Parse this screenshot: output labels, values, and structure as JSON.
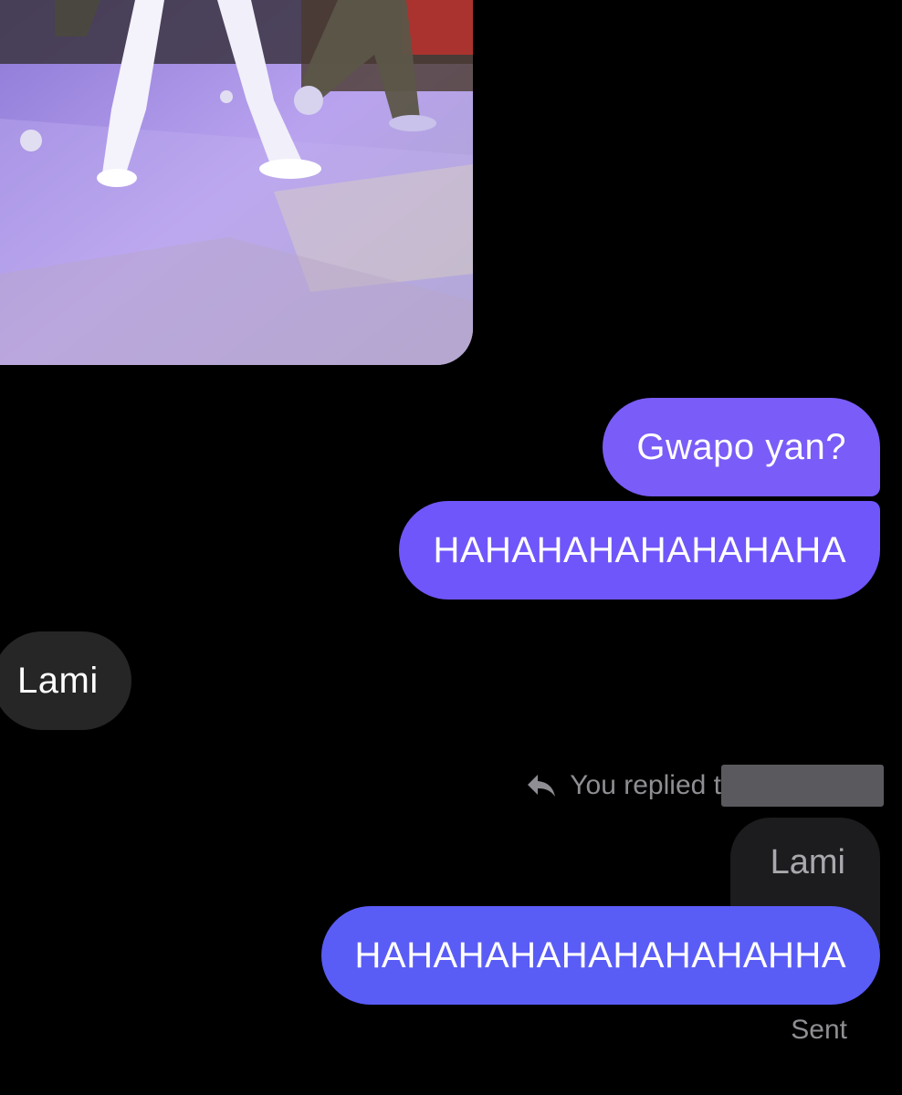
{
  "conversation": {
    "messages": [
      {
        "kind": "photo",
        "direction": "incoming"
      },
      {
        "kind": "text",
        "direction": "outgoing",
        "text": "Gwapo yan?"
      },
      {
        "kind": "text",
        "direction": "outgoing",
        "text": "HAHAHAHAHAHAHAHA"
      },
      {
        "kind": "text",
        "direction": "incoming",
        "text": "Lami"
      },
      {
        "kind": "reply",
        "direction": "outgoing",
        "reply_note": "You replied t",
        "quoted_text": "Lami",
        "text": "HAHAHAHAHAHAHAHAHHA"
      }
    ],
    "status": "Sent"
  },
  "colors": {
    "background": "#000000",
    "outgoing_bubble": "#7a5cf8",
    "incoming_bubble": "#262626",
    "quoted_bubble": "#1c1c1e",
    "muted_text": "#8e8e93"
  },
  "icons": {
    "reply": "reply-arrow-icon"
  }
}
